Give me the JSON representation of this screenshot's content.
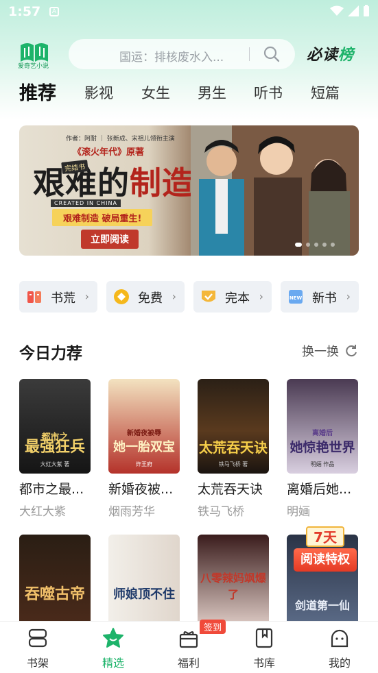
{
  "status": {
    "time": "1:57"
  },
  "header": {
    "logo_text": "爱奇艺小说",
    "search_placeholder": "国运：排核废水入...",
    "rank_label_a": "必读",
    "rank_label_b": "榜"
  },
  "tabs": [
    {
      "label": "推荐",
      "active": true
    },
    {
      "label": "影视"
    },
    {
      "label": "女生"
    },
    {
      "label": "男生"
    },
    {
      "label": "听书"
    },
    {
      "label": "短篇"
    }
  ],
  "banner": {
    "credits": "作者：阿耐 ｜ 张新成、宋祖儿领衔主演",
    "origin": "《滚火年代》原著",
    "tag": "完结书",
    "title_a": "艰难的",
    "title_b": "制造",
    "english": "CREATED IN CHINA",
    "slogan": "艰难制造 破局重生!",
    "cta": "立即阅读",
    "dots": 5,
    "active_dot": 0
  },
  "quick": [
    {
      "label": "书荒",
      "icon": "gift-box-icon",
      "color": "#f0564a"
    },
    {
      "label": "免费",
      "icon": "coin-icon",
      "color": "#f5b81c"
    },
    {
      "label": "完本",
      "icon": "check-shield-icon",
      "color": "#f4b73a"
    },
    {
      "label": "新书",
      "icon": "new-book-icon",
      "color": "#4a90e2"
    }
  ],
  "section": {
    "title": "今日力荐",
    "refresh": "换一换"
  },
  "books_row1": [
    {
      "title": "都市之最...",
      "author": "大红大紫",
      "cover_title": "最强狂兵",
      "cover_sub": "都市之",
      "cover_author": "大红大紫 著"
    },
    {
      "title": "新婚夜被...",
      "author": "烟雨芳华",
      "cover_title": "她一胎双宝",
      "cover_sub": "新婚夜被辱",
      "cover_author": "炸王府"
    },
    {
      "title": "太荒吞天诀",
      "author": "铁马飞桥",
      "cover_title": "太荒吞天诀",
      "cover_sub": "铁马飞桥 著",
      "cover_author": ""
    },
    {
      "title": "离婚后她...",
      "author": "明婳",
      "cover_title": "她惊艳世界",
      "cover_sub": "离婚后",
      "cover_author": "明婳 作品"
    }
  ],
  "books_row2": [
    {
      "cover_title": "吞噬古帝"
    },
    {
      "cover_title": "师娘顶不住"
    },
    {
      "cover_title": "八零辣妈飒爆了"
    },
    {
      "cover_title": "剑道第一仙"
    }
  ],
  "promo": {
    "days": "7天",
    "label": "阅读特权"
  },
  "nav": [
    {
      "label": "书架",
      "icon": "bookshelf-icon"
    },
    {
      "label": "精选",
      "icon": "star-icon",
      "active": true
    },
    {
      "label": "福利",
      "icon": "gift-icon"
    },
    {
      "label": "书库",
      "icon": "library-icon"
    },
    {
      "label": "我的",
      "icon": "profile-icon"
    }
  ],
  "nav_badge": "签到",
  "colors": {
    "accent": "#1db36a",
    "badge": "#f04a3a"
  }
}
